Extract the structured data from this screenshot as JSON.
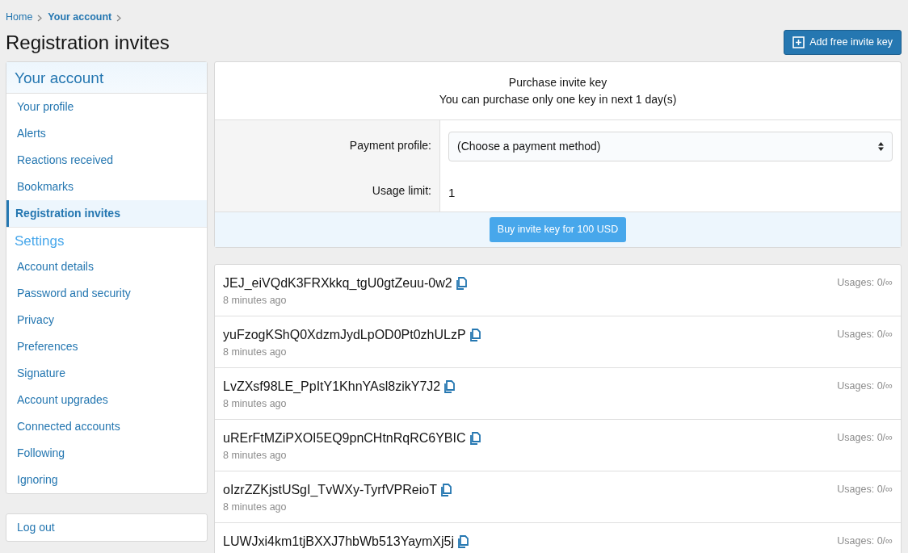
{
  "breadcrumb": [
    {
      "label": "Home",
      "current": false
    },
    {
      "label": "Your account",
      "current": true
    }
  ],
  "title": "Registration invites",
  "add_button": "Add free invite key",
  "sidebar": {
    "items": [
      {
        "kind": "header",
        "label": "Your account",
        "selected": false
      },
      {
        "kind": "link",
        "label": "Your profile",
        "selected": false
      },
      {
        "kind": "link",
        "label": "Alerts",
        "selected": false
      },
      {
        "kind": "link",
        "label": "Reactions received",
        "selected": false
      },
      {
        "kind": "link",
        "label": "Bookmarks",
        "selected": false
      },
      {
        "kind": "link",
        "label": "Registration invites",
        "selected": true
      },
      {
        "kind": "header",
        "label": "Settings",
        "selected": false
      },
      {
        "kind": "link",
        "label": "Account details",
        "selected": false
      },
      {
        "kind": "link",
        "label": "Password and security",
        "selected": false
      },
      {
        "kind": "link",
        "label": "Privacy",
        "selected": false
      },
      {
        "kind": "link",
        "label": "Preferences",
        "selected": false
      },
      {
        "kind": "link",
        "label": "Signature",
        "selected": false
      },
      {
        "kind": "link",
        "label": "Account upgrades",
        "selected": false
      },
      {
        "kind": "link",
        "label": "Connected accounts",
        "selected": false
      },
      {
        "kind": "link",
        "label": "Following",
        "selected": false
      },
      {
        "kind": "link",
        "label": "Ignoring",
        "selected": false
      }
    ],
    "logout": "Log out"
  },
  "purchase": {
    "title": "Purchase invite key",
    "note": "You can purchase only one key in next 1 day(s)",
    "payment_label": "Payment profile:",
    "payment_value": "(Choose a payment method)",
    "limit_label": "Usage limit:",
    "limit_value": "1",
    "buy_button": "Buy invite key for 100 USD"
  },
  "keys": [
    {
      "key": "JEJ_eiVQdK3FRXkkq_tgU0gtZeuu-0w2",
      "time": "8 minutes ago",
      "usages": "Usages: 0/∞"
    },
    {
      "key": "yuFzogKShQ0XdzmJydLpOD0Pt0zhULzP",
      "time": "8 minutes ago",
      "usages": "Usages: 0/∞"
    },
    {
      "key": "LvZXsf98LE_PpItY1KhnYAsl8zikY7J2",
      "time": "8 minutes ago",
      "usages": "Usages: 0/∞"
    },
    {
      "key": "uRErFtMZiPXOI5EQ9pnCHtnRqRC6YBIC",
      "time": "8 minutes ago",
      "usages": "Usages: 0/∞"
    },
    {
      "key": "oIzrZZKjstUSgI_TvWXy-TyrfVPReioT",
      "time": "8 minutes ago",
      "usages": "Usages: 0/∞"
    },
    {
      "key": "LUWJxi4km1tjBXXJ7hbWb513YaymXj5j",
      "usages": "Usages: 0/∞"
    }
  ]
}
